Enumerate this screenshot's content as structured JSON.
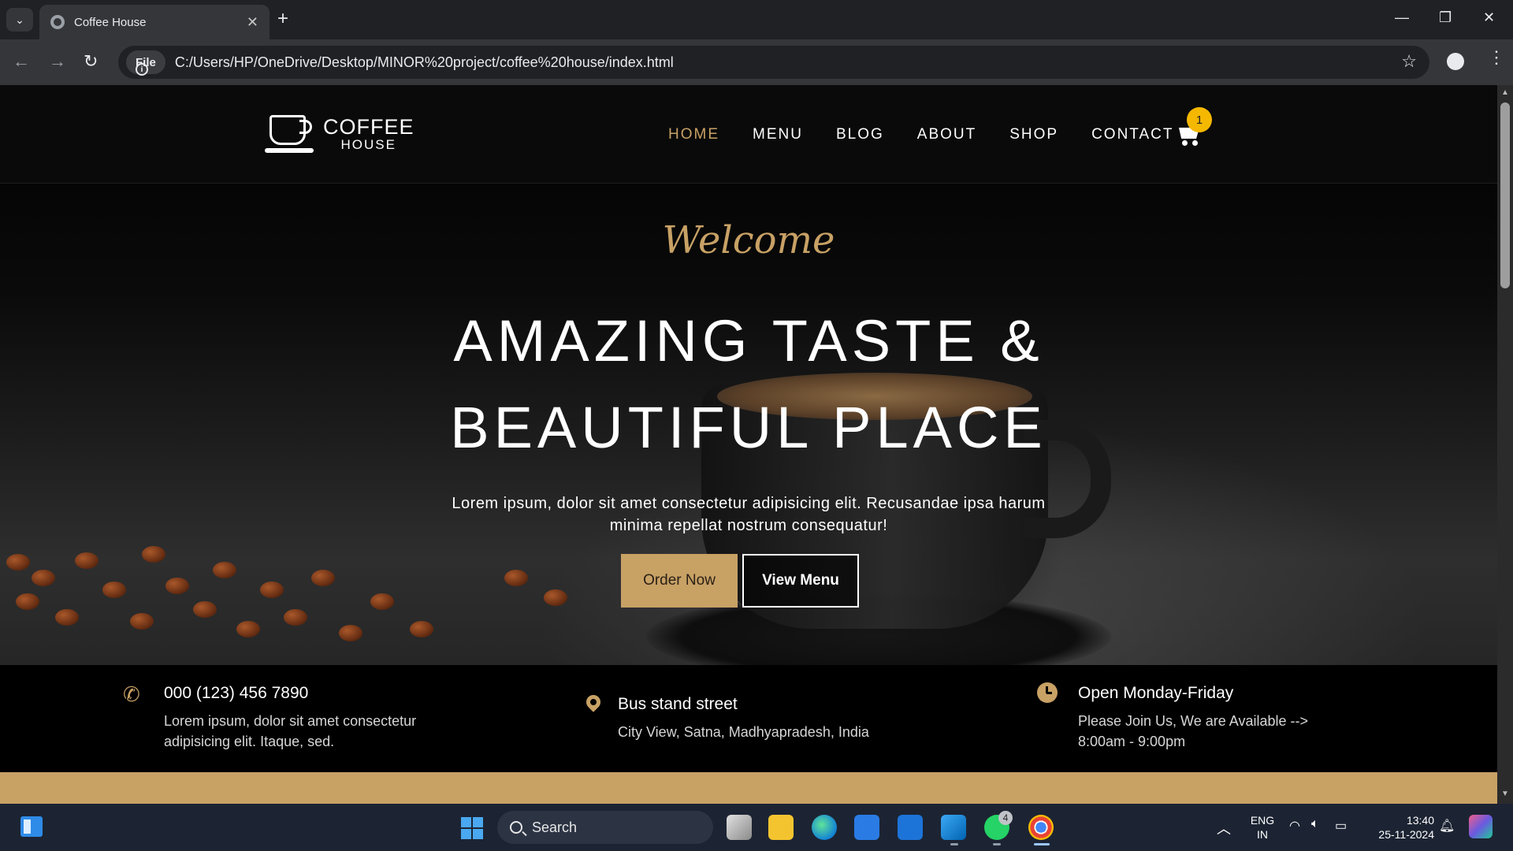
{
  "browser": {
    "tab_title": "Coffee House",
    "address_chip": "File",
    "url": "C:/Users/HP/OneDrive/Desktop/MINOR%20project/coffee%20house/index.html"
  },
  "site": {
    "logo_line1": "COFFEE",
    "logo_line2": "HOUSE",
    "nav": [
      "HOME",
      "MENU",
      "BLOG",
      "ABOUT",
      "SHOP",
      "CONTACT"
    ],
    "active_nav": "HOME",
    "cart_count": "1",
    "accent_color": "#c8a165"
  },
  "hero": {
    "script_title": "Welcome",
    "headline_line1": "AMAZING TASTE &",
    "headline_line2": "BEAUTIFUL PLACE",
    "subtext": "Lorem ipsum, dolor sit amet consectetur adipisicing elit. Recusandae ipsa harum minima repellat nostrum consequatur!",
    "order_button": "Order Now",
    "menu_button": "View Menu"
  },
  "info": [
    {
      "icon": "phone-icon",
      "heading": "000 (123) 456 7890",
      "line1": "Lorem ipsum, dolor sit amet consectetur",
      "line2": "adipisicing elit. Itaque, sed."
    },
    {
      "icon": "map-pin-icon",
      "heading": "Bus stand street",
      "line1": "City View, Satna, Madhyapradesh, India",
      "line2": ""
    },
    {
      "icon": "clock-icon",
      "heading": "Open Monday-Friday",
      "line1": "Please Join Us, We are Available -->",
      "line2": "8:00am - 9:00pm"
    }
  ],
  "taskbar": {
    "search_placeholder": "Search",
    "whatsapp_badge": "4",
    "language_line1": "ENG",
    "language_line2": "IN",
    "time": "13:40",
    "date": "25-11-2024"
  }
}
